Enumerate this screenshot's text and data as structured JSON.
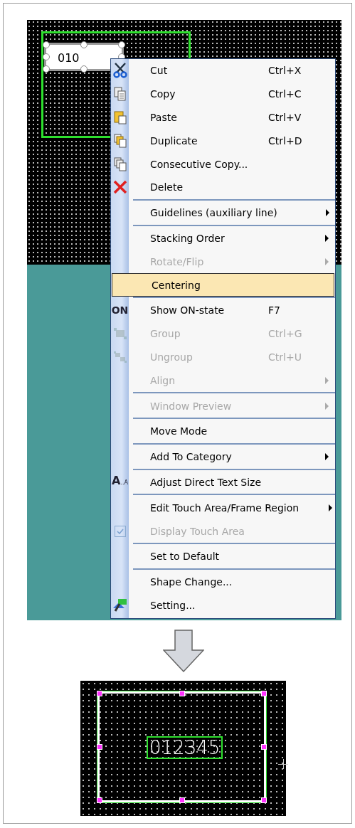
{
  "editor_before": {
    "object_text": "010"
  },
  "context_menu": {
    "items": [
      {
        "label": "Cut",
        "shortcut": "Ctrl+X",
        "disabled": false,
        "selected": false,
        "submenu": false,
        "separator_before": false
      },
      {
        "label": "Copy",
        "shortcut": "Ctrl+C",
        "disabled": false,
        "selected": false,
        "submenu": false,
        "separator_before": false
      },
      {
        "label": "Paste",
        "shortcut": "Ctrl+V",
        "disabled": false,
        "selected": false,
        "submenu": false,
        "separator_before": false
      },
      {
        "label": "Duplicate",
        "shortcut": "Ctrl+D",
        "disabled": false,
        "selected": false,
        "submenu": false,
        "separator_before": false
      },
      {
        "label": "Consecutive Copy...",
        "disabled": false,
        "selected": false,
        "submenu": false,
        "separator_before": false
      },
      {
        "label": "Delete",
        "disabled": false,
        "selected": false,
        "submenu": false,
        "separator_before": false
      },
      {
        "label": "Guidelines (auxiliary line)",
        "disabled": false,
        "selected": false,
        "submenu": true,
        "separator_before": true
      },
      {
        "label": "Stacking Order",
        "disabled": false,
        "selected": false,
        "submenu": true,
        "separator_before": true
      },
      {
        "label": "Rotate/Flip",
        "disabled": true,
        "selected": false,
        "submenu": true,
        "separator_before": false
      },
      {
        "label": "Centering",
        "disabled": false,
        "selected": true,
        "submenu": false,
        "separator_before": false
      },
      {
        "icon_text": "ON",
        "label": "Show ON-state",
        "shortcut": "F7",
        "disabled": false,
        "selected": false,
        "submenu": false,
        "separator_before": true
      },
      {
        "label": "Group",
        "shortcut": "Ctrl+G",
        "disabled": true,
        "selected": false,
        "submenu": false,
        "separator_before": false
      },
      {
        "label": "Ungroup",
        "shortcut": "Ctrl+U",
        "disabled": true,
        "selected": false,
        "submenu": false,
        "separator_before": false
      },
      {
        "label": "Align",
        "disabled": true,
        "selected": false,
        "submenu": true,
        "separator_before": false
      },
      {
        "label": "Window Preview",
        "disabled": true,
        "selected": false,
        "submenu": true,
        "separator_before": true
      },
      {
        "label": "Move Mode",
        "disabled": false,
        "selected": false,
        "submenu": false,
        "separator_before": true
      },
      {
        "label": "Add To Category",
        "disabled": false,
        "selected": false,
        "submenu": true,
        "separator_before": true
      },
      {
        "icon_text": "**A**$_{..A}$",
        "label": "Adjust Direct Text Size",
        "disabled": false,
        "selected": false,
        "submenu": false,
        "separator_before": true
      },
      {
        "label": "Edit Touch Area/Frame Region",
        "disabled": false,
        "selected": false,
        "submenu": true,
        "separator_before": true
      },
      {
        "label": "Display Touch Area",
        "disabled": true,
        "selected": false,
        "submenu": false,
        "separator_before": false,
        "checked": true
      },
      {
        "label": "Set to Default",
        "disabled": false,
        "selected": false,
        "submenu": false,
        "separator_before": true
      },
      {
        "label": "Shape Change...",
        "disabled": false,
        "selected": false,
        "submenu": false,
        "separator_before": true
      },
      {
        "label": "Setting...",
        "disabled": false,
        "selected": false,
        "submenu": false,
        "separator_before": false
      }
    ]
  },
  "editor_after": {
    "object_text": "012345"
  }
}
